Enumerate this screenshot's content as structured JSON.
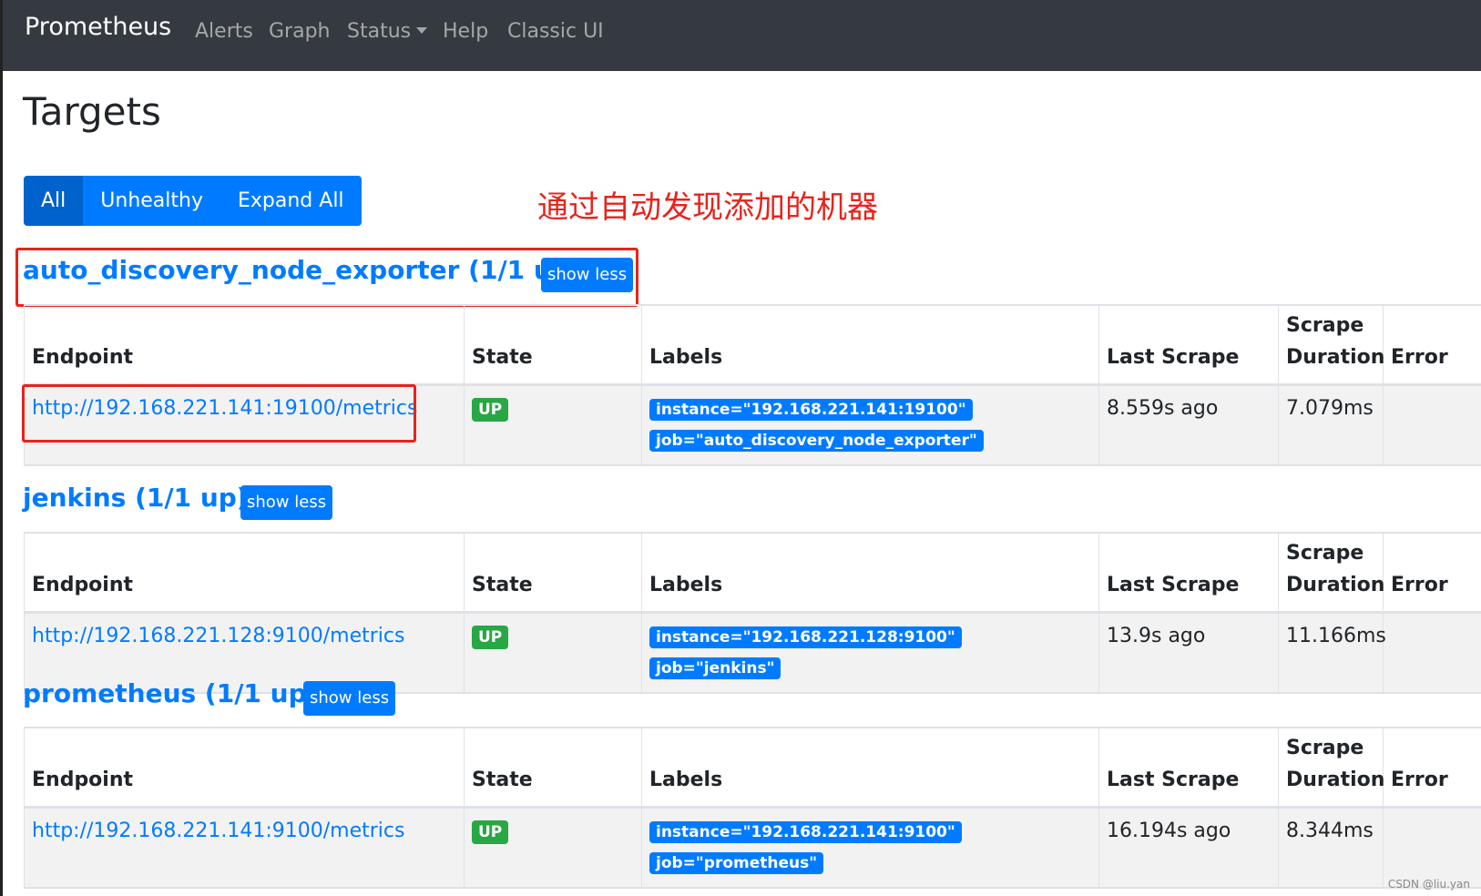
{
  "navbar": {
    "brand": "Prometheus",
    "items": [
      "Alerts",
      "Graph",
      "Status",
      "Help",
      "Classic UI"
    ]
  },
  "page": {
    "title": "Targets",
    "filters": [
      "All",
      "Unhealthy",
      "Expand All"
    ],
    "annotation": "通过自动发现添加的机器"
  },
  "columns": [
    "Endpoint",
    "State",
    "Labels",
    "Last Scrape",
    "Scrape",
    "Duration",
    "Error"
  ],
  "pools": [
    {
      "title": "auto_discovery_node_exporter (1/1 up)",
      "toggle": "show less",
      "endpoint": "http://192.168.221.141:19100/metrics",
      "state": "UP",
      "labels": [
        "instance=\"192.168.221.141:19100\"",
        "job=\"auto_discovery_node_exporter\""
      ],
      "last_scrape": "8.559s ago",
      "duration": "7.079ms",
      "error": ""
    },
    {
      "title": "jenkins (1/1 up)",
      "toggle": "show less",
      "endpoint": "http://192.168.221.128:9100/metrics",
      "state": "UP",
      "labels": [
        "instance=\"192.168.221.128:9100\"",
        "job=\"jenkins\""
      ],
      "last_scrape": "13.9s ago",
      "duration": "11.166ms",
      "error": ""
    },
    {
      "title": "prometheus (1/1 up)",
      "toggle": "show less",
      "endpoint": "http://192.168.221.141:9100/metrics",
      "state": "UP",
      "labels": [
        "instance=\"192.168.221.141:9100\"",
        "job=\"prometheus\""
      ],
      "last_scrape": "16.194s ago",
      "duration": "8.344ms",
      "error": ""
    }
  ],
  "watermark": "CSDN @liu.yan",
  "colors": {
    "navbar": "#343a40",
    "primary": "#007bff",
    "success": "#28a745",
    "annotation": "#e8231b"
  }
}
